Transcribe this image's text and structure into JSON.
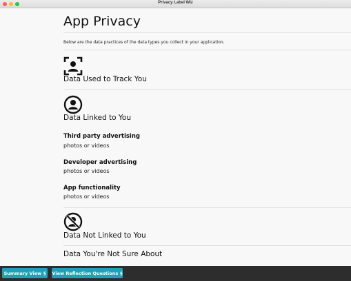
{
  "window": {
    "title": "Privacy Label Wiz"
  },
  "page": {
    "title": "App Privacy",
    "intro": "Below are the data practices of the data types you collect in your application."
  },
  "sections": {
    "tracking": {
      "title": "Data Used to Track You",
      "icon": "tracking-person-icon"
    },
    "linked": {
      "title": "Data Linked to You",
      "icon": "user-circle-icon",
      "items": [
        {
          "type": "Third party advertising",
          "value": "photos or videos"
        },
        {
          "type": "Developer advertising",
          "value": "photos or videos"
        },
        {
          "type": "App functionality",
          "value": "photos or videos"
        }
      ]
    },
    "not_linked": {
      "title": "Data Not Linked to You",
      "icon": "user-slash-icon"
    },
    "not_sure": {
      "title": "Data You're Not Sure About"
    }
  },
  "footer": {
    "summary_label": "Summary View",
    "reflection_label": "View Reflection Questions",
    "button_icon": "§"
  },
  "colors": {
    "accent": "#1fa2b8",
    "footer_bg": "#2d2d2d",
    "page_bg": "#f8f8f9"
  }
}
